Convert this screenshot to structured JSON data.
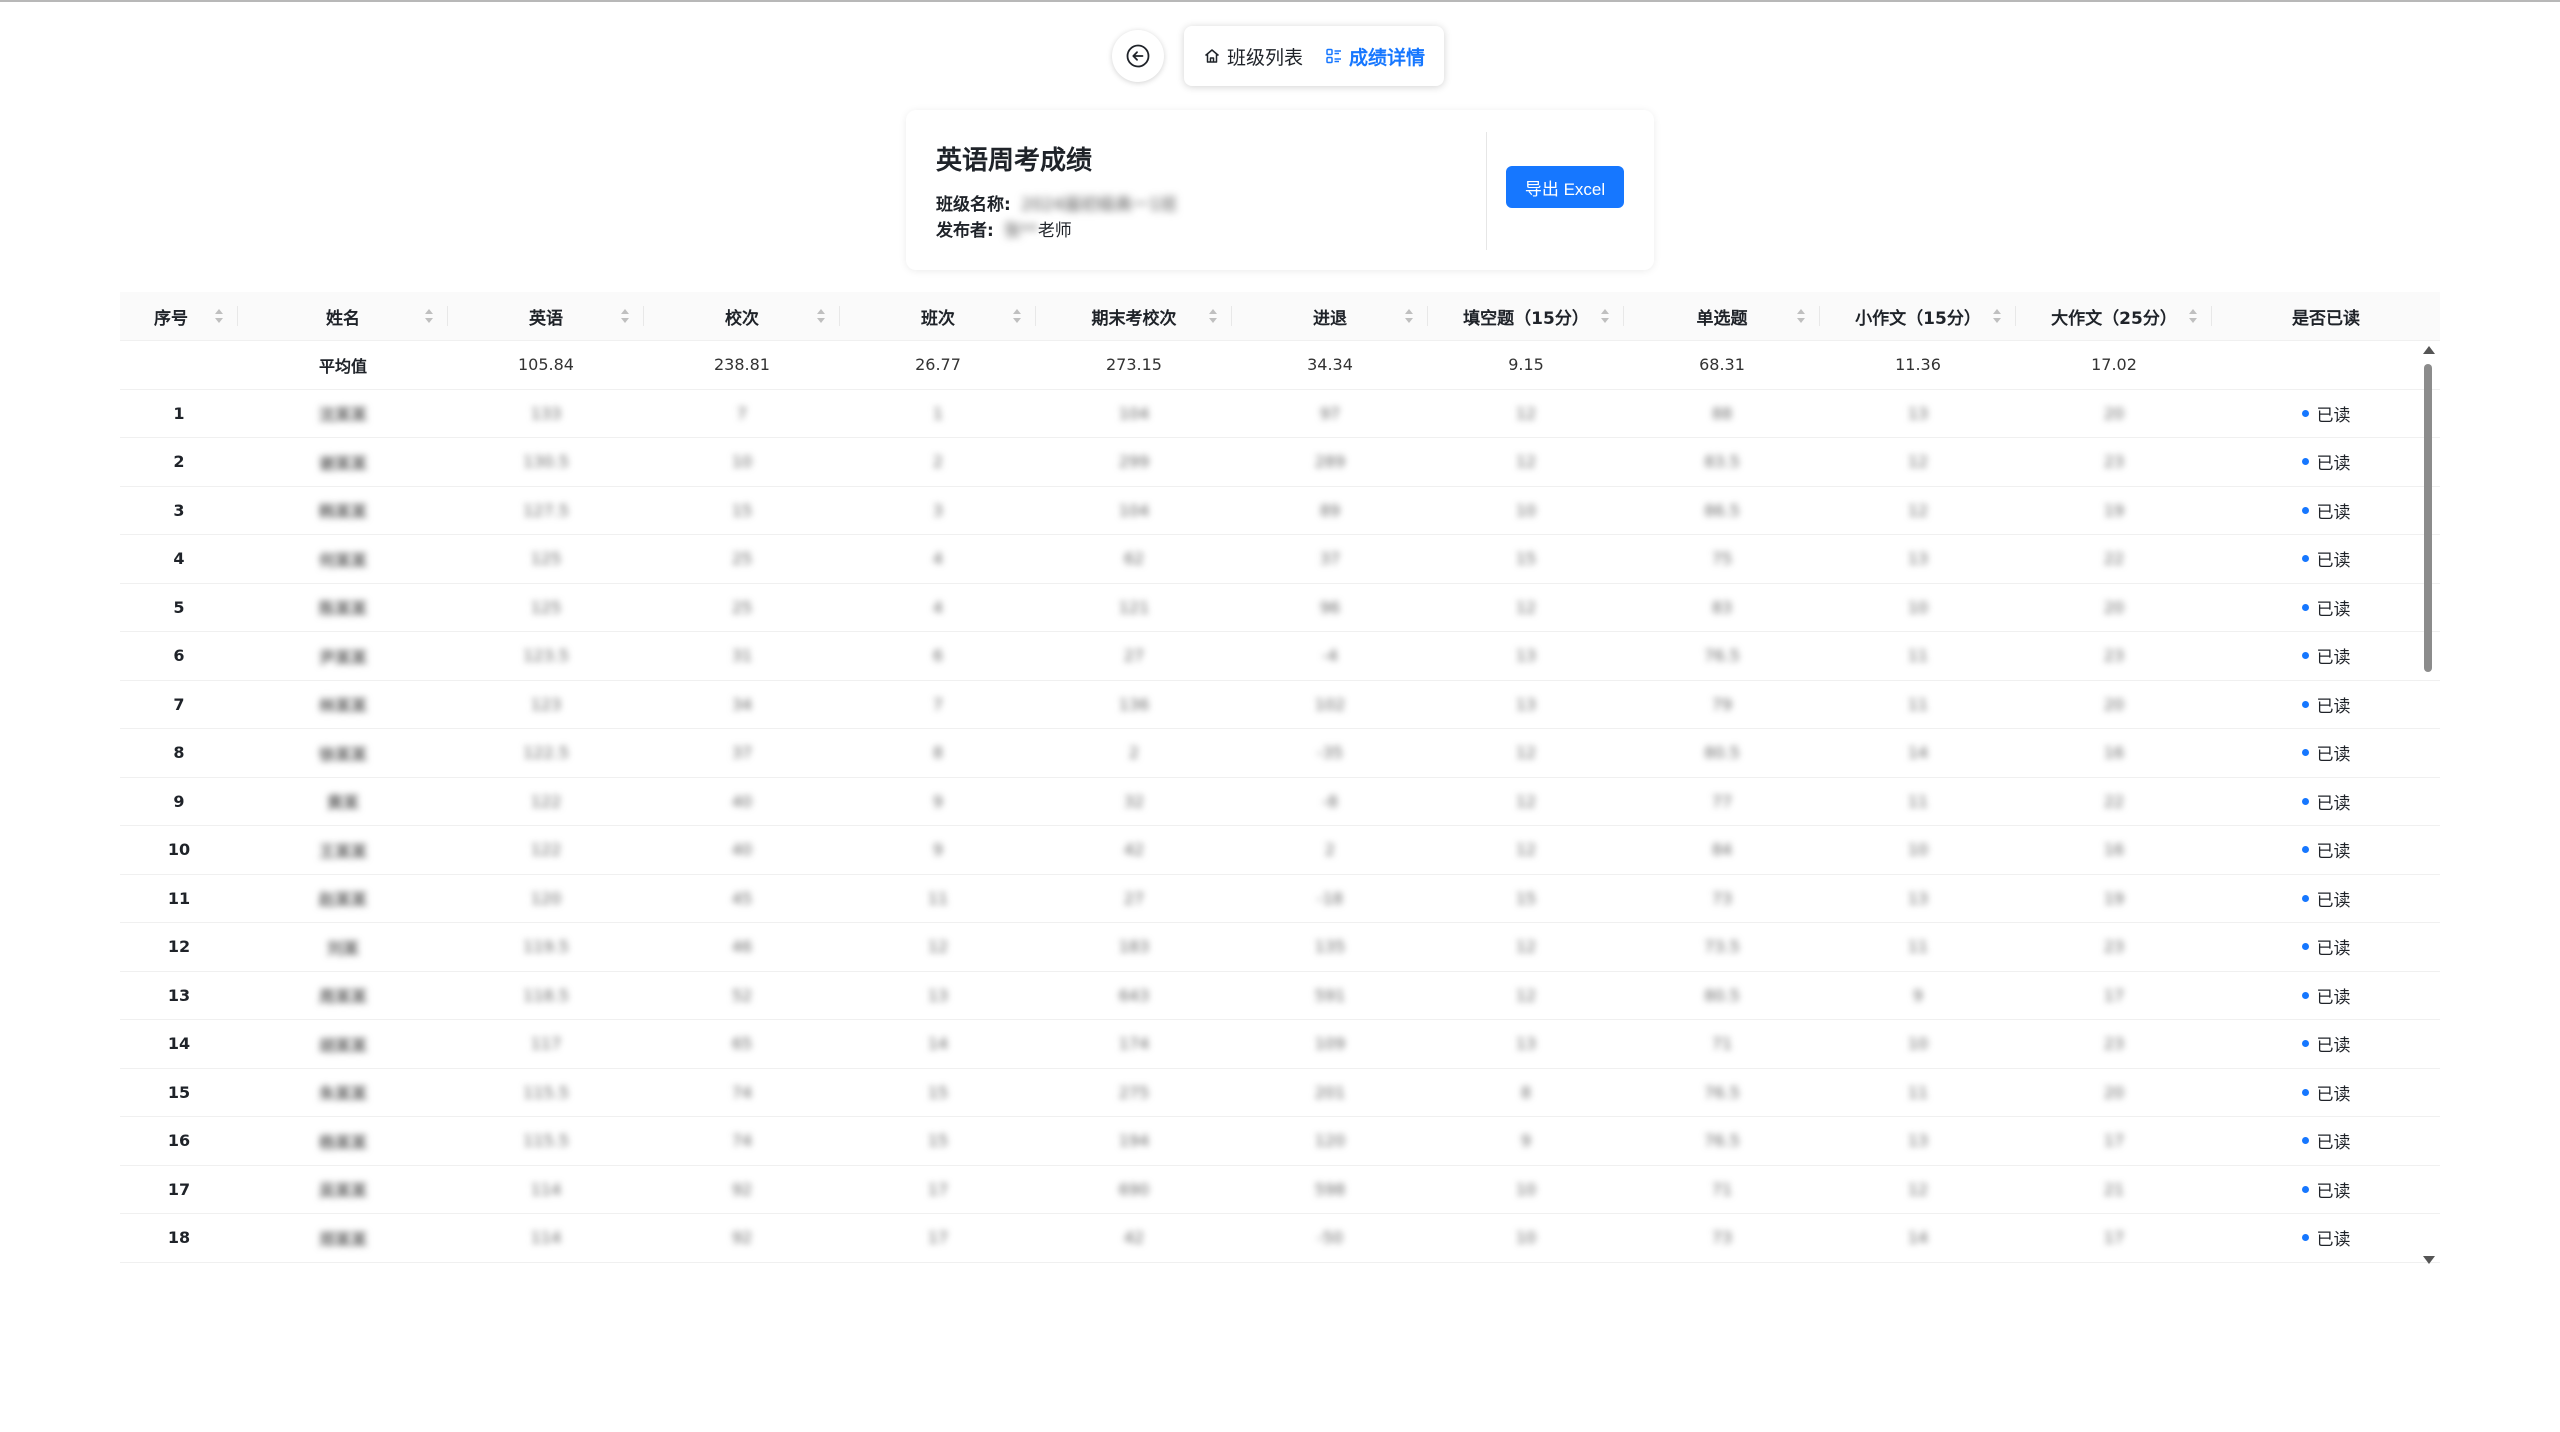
{
  "nav": {
    "back_icon": "arrow-left-circle-icon",
    "tabs": [
      {
        "label": "班级列表",
        "icon": "home-icon",
        "active": false
      },
      {
        "label": "成绩详情",
        "icon": "list-icon",
        "active": true
      }
    ]
  },
  "card": {
    "title": "英语周考成绩",
    "class_label": "班级名称:",
    "class_value": "2024届初级高一1班",
    "publisher_label": "发布者:",
    "publisher_value": "张**",
    "publisher_suffix": "老师",
    "export_label": "导出 Excel"
  },
  "colors": {
    "accent": "#1677ff"
  },
  "table": {
    "columns": [
      "序号",
      "姓名",
      "英语",
      "校次",
      "班次",
      "期末考校次",
      "进退",
      "填空题（15分）",
      "单选题",
      "小作文（15分）",
      "大作文（25分）",
      "是否已读"
    ],
    "average": {
      "label": "平均值",
      "values": [
        "105.84",
        "238.81",
        "26.77",
        "273.15",
        "34.34",
        "9.15",
        "68.31",
        "11.36",
        "17.02"
      ]
    },
    "rows": [
      {
        "idx": "1",
        "name": "沈某某",
        "vals": [
          "133",
          "7",
          "1",
          "104",
          "97",
          "12",
          "88",
          "13",
          "20"
        ],
        "read": "已读"
      },
      {
        "idx": "2",
        "name": "谢某某",
        "vals": [
          "130.5",
          "10",
          "2",
          "299",
          "289",
          "12",
          "83.5",
          "12",
          "23"
        ],
        "read": "已读"
      },
      {
        "idx": "3",
        "name": "韩某某",
        "vals": [
          "127.5",
          "15",
          "3",
          "104",
          "89",
          "10",
          "86.5",
          "12",
          "19"
        ],
        "read": "已读"
      },
      {
        "idx": "4",
        "name": "何某某",
        "vals": [
          "125",
          "25",
          "4",
          "62",
          "37",
          "15",
          "75",
          "13",
          "22"
        ],
        "read": "已读"
      },
      {
        "idx": "5",
        "name": "陈某某",
        "vals": [
          "125",
          "25",
          "4",
          "121",
          "96",
          "12",
          "83",
          "10",
          "20"
        ],
        "read": "已读"
      },
      {
        "idx": "6",
        "name": "尹某某",
        "vals": [
          "123.5",
          "31",
          "6",
          "27",
          "-4",
          "13",
          "76.5",
          "11",
          "23"
        ],
        "read": "已读"
      },
      {
        "idx": "7",
        "name": "林某某",
        "vals": [
          "123",
          "34",
          "7",
          "136",
          "102",
          "13",
          "79",
          "11",
          "20"
        ],
        "read": "已读"
      },
      {
        "idx": "8",
        "name": "徐某某",
        "vals": [
          "122.5",
          "37",
          "8",
          "2",
          "-35",
          "12",
          "80.5",
          "14",
          "16"
        ],
        "read": "已读"
      },
      {
        "idx": "9",
        "name": "黄某",
        "vals": [
          "122",
          "40",
          "9",
          "32",
          "-8",
          "12",
          "77",
          "11",
          "22"
        ],
        "read": "已读"
      },
      {
        "idx": "10",
        "name": "王某某",
        "vals": [
          "122",
          "40",
          "9",
          "42",
          "2",
          "12",
          "84",
          "10",
          "16"
        ],
        "read": "已读"
      },
      {
        "idx": "11",
        "name": "赵某某",
        "vals": [
          "120",
          "45",
          "11",
          "27",
          "-18",
          "15",
          "73",
          "13",
          "19"
        ],
        "read": "已读"
      },
      {
        "idx": "12",
        "name": "刘某",
        "vals": [
          "119.5",
          "46",
          "12",
          "183",
          "135",
          "12",
          "73.5",
          "11",
          "23"
        ],
        "read": "已读"
      },
      {
        "idx": "13",
        "name": "周某某",
        "vals": [
          "118.5",
          "52",
          "13",
          "643",
          "591",
          "12",
          "80.5",
          "9",
          "17"
        ],
        "read": "已读"
      },
      {
        "idx": "14",
        "name": "胡某某",
        "vals": [
          "117",
          "65",
          "14",
          "174",
          "109",
          "13",
          "71",
          "10",
          "23"
        ],
        "read": "已读"
      },
      {
        "idx": "15",
        "name": "朱某某",
        "vals": [
          "115.5",
          "74",
          "15",
          "275",
          "201",
          "8",
          "76.5",
          "11",
          "20"
        ],
        "read": "已读"
      },
      {
        "idx": "16",
        "name": "杨某某",
        "vals": [
          "115.5",
          "74",
          "15",
          "194",
          "120",
          "9",
          "76.5",
          "13",
          "17"
        ],
        "read": "已读"
      },
      {
        "idx": "17",
        "name": "吴某某",
        "vals": [
          "114",
          "92",
          "17",
          "690",
          "598",
          "10",
          "71",
          "12",
          "21"
        ],
        "read": "已读"
      },
      {
        "idx": "18",
        "name": "郑某某",
        "vals": [
          "114",
          "92",
          "17",
          "42",
          "-50",
          "10",
          "73",
          "14",
          "17"
        ],
        "read": "已读"
      }
    ]
  }
}
